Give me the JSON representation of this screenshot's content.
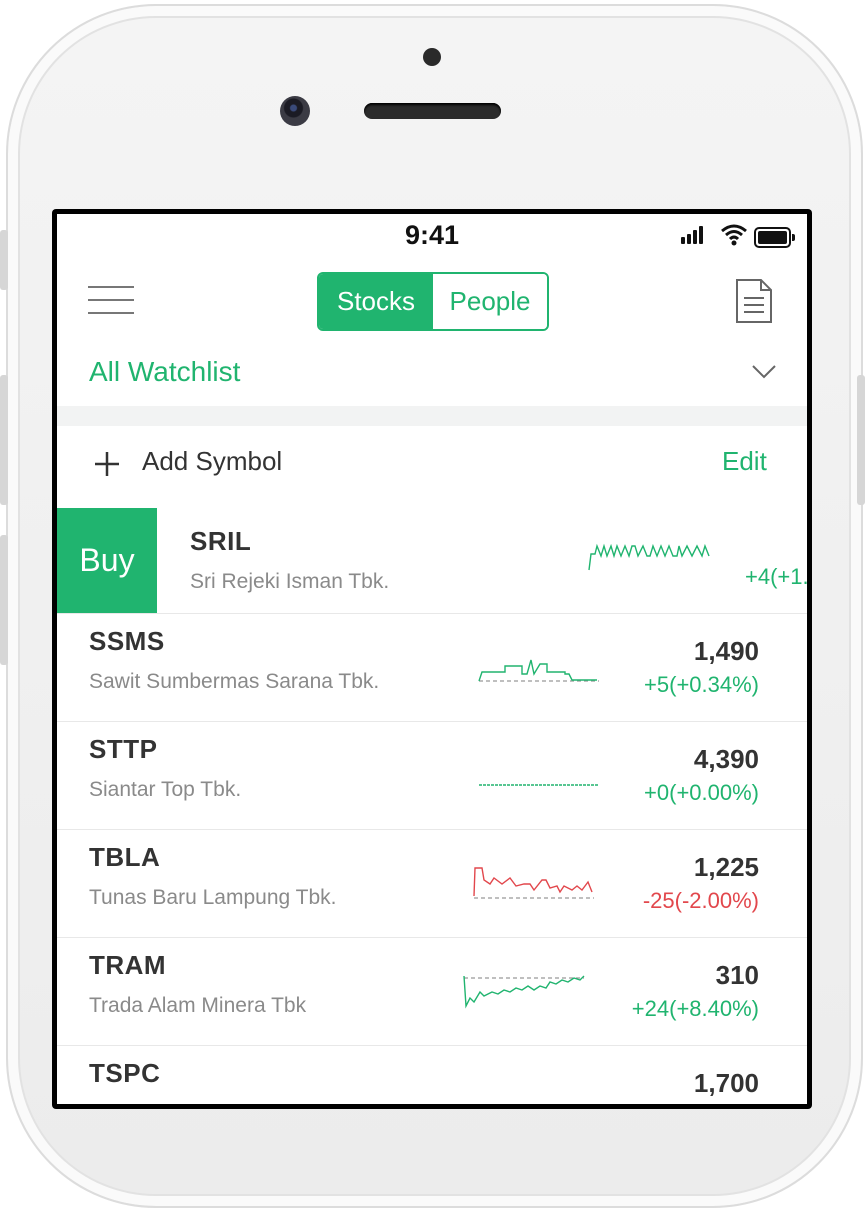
{
  "status": {
    "time": "9:41"
  },
  "header": {
    "tabs": [
      {
        "label": "Stocks",
        "active": true
      },
      {
        "label": "People",
        "active": false
      }
    ]
  },
  "watchlist": {
    "selected": "All Watchlist"
  },
  "actions": {
    "add_label": "Add Symbol",
    "edit_label": "Edit"
  },
  "buy_row": {
    "action_label": "Buy",
    "symbol": "SRIL",
    "name": "Sri Rejeki Isman Tbk.",
    "change": "+4(+1."
  },
  "rows": [
    {
      "symbol": "SSMS",
      "name": "Sawit Sumbermas Sarana Tbk.",
      "price": "1,490",
      "change": "+5(+0.34%)",
      "direction": "up"
    },
    {
      "symbol": "STTP",
      "name": "Siantar Top Tbk.",
      "price": "4,390",
      "change": "+0(+0.00%)",
      "direction": "up"
    },
    {
      "symbol": "TBLA",
      "name": "Tunas Baru Lampung Tbk.",
      "price": "1,225",
      "change": "-25(-2.00%)",
      "direction": "down"
    },
    {
      "symbol": "TRAM",
      "name": "Trada Alam Minera Tbk",
      "price": "310",
      "change": "+24(+8.40%)",
      "direction": "up"
    },
    {
      "symbol": "TSPC",
      "name": "",
      "price": "1,700",
      "change": "",
      "direction": "up"
    }
  ],
  "colors": {
    "accent": "#20b46f",
    "negative": "#e2474c",
    "text": "#333333",
    "muted": "#8a8a8a"
  },
  "icons": [
    "menu-icon",
    "document-icon",
    "chevron-down-icon",
    "plus-icon",
    "signal-icon",
    "wifi-icon",
    "battery-icon"
  ]
}
